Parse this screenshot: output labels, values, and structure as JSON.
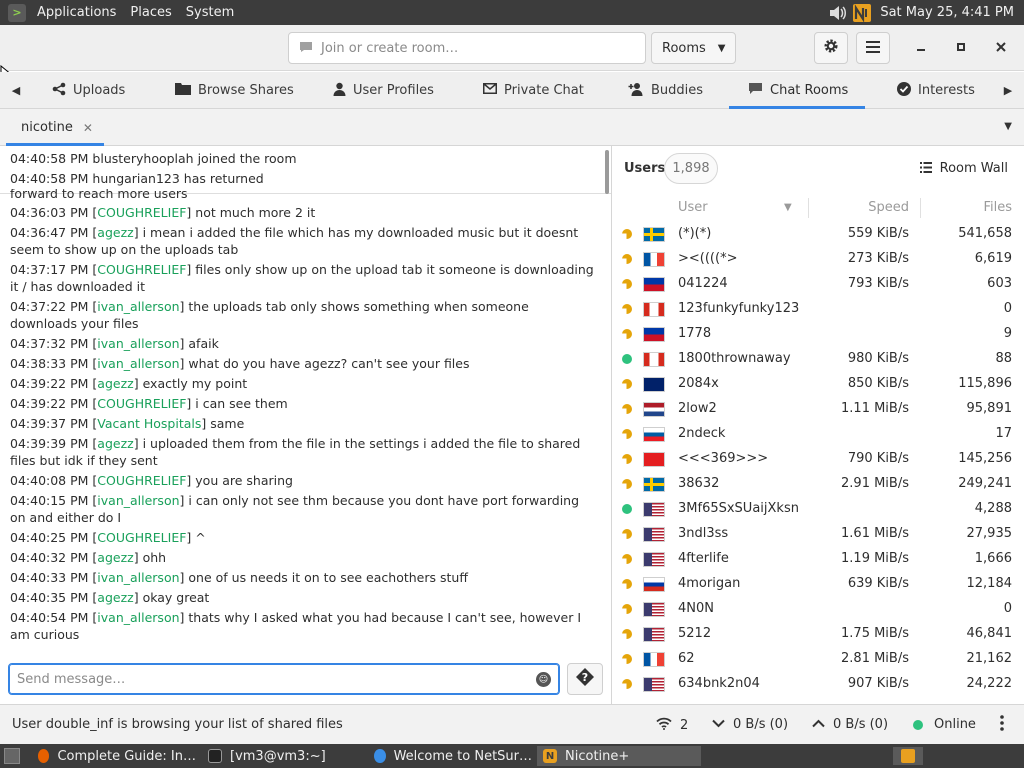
{
  "top_panel": {
    "menus": [
      "Applications",
      "Places",
      "System"
    ],
    "clock": "Sat May 25,  4:41 PM"
  },
  "header": {
    "search_placeholder": "Join or create room…",
    "rooms_label": "Rooms"
  },
  "tabs": [
    {
      "label": "Uploads",
      "icon": "share-icon"
    },
    {
      "label": "Browse Shares",
      "icon": "folder-icon"
    },
    {
      "label": "User Profiles",
      "icon": "person-icon"
    },
    {
      "label": "Private Chat",
      "icon": "envelope-icon"
    },
    {
      "label": "Buddies",
      "icon": "add-person-icon"
    },
    {
      "label": "Chat Rooms",
      "icon": "chat-icon",
      "active": true
    },
    {
      "label": "Interests",
      "icon": "check-circle-icon"
    }
  ],
  "room_tab": {
    "label": "nicotine"
  },
  "chat": {
    "pinned": [
      {
        "time": "04:40:58 PM",
        "text": "blusteryhooplah joined the room"
      },
      {
        "time": "04:40:58 PM",
        "text": "hungarian123 has returned"
      }
    ],
    "partial_line": "forward to reach more users",
    "messages": [
      {
        "time": "04:36:03 PM",
        "user": "COUGHRELIEF",
        "text": "not much more 2 it"
      },
      {
        "time": "04:36:47 PM",
        "user": "agezz",
        "text": "i mean i added the file which has my downloaded music but it doesnt seem to show up on the uploads tab"
      },
      {
        "time": "04:37:17 PM",
        "user": "COUGHRELIEF",
        "text": "files only show up on the upload tab it someone is downloading it / has downloaded it"
      },
      {
        "time": "04:37:22 PM",
        "user": "ivan_allerson",
        "text": "the uploads tab only shows something when someone downloads your files"
      },
      {
        "time": "04:37:32 PM",
        "user": "ivan_allerson",
        "text": "afaik"
      },
      {
        "time": "04:38:33 PM",
        "user": "ivan_allerson",
        "text": "what do you have agezz? can't see your files"
      },
      {
        "time": "04:39:22 PM",
        "user": "agezz",
        "text": "exactly my point"
      },
      {
        "time": "04:39:22 PM",
        "user": "COUGHRELIEF",
        "text": "i can see them"
      },
      {
        "time": "04:39:37 PM",
        "user": "Vacant Hospitals",
        "text": "same"
      },
      {
        "time": "04:39:39 PM",
        "user": "agezz",
        "text": "i uploaded them from the file in the settings i added the file to shared files but idk if they sent"
      },
      {
        "time": "04:40:08 PM",
        "user": "COUGHRELIEF",
        "text": "you are sharing"
      },
      {
        "time": "04:40:15 PM",
        "user": "ivan_allerson",
        "text": "i can only not see thm because you dont have port forwarding on and either do I"
      },
      {
        "time": "04:40:25 PM",
        "user": "COUGHRELIEF",
        "text": "^"
      },
      {
        "time": "04:40:32 PM",
        "user": "agezz",
        "text": "ohh"
      },
      {
        "time": "04:40:33 PM",
        "user": "ivan_allerson",
        "text": "one of us needs it on to see eachothers stuff"
      },
      {
        "time": "04:40:35 PM",
        "user": "agezz",
        "text": "okay great"
      },
      {
        "time": "04:40:54 PM",
        "user": "ivan_allerson",
        "text": "thats why I asked what you had because I can't see, however I am curious"
      }
    ],
    "input_placeholder": "Send message…"
  },
  "users_pane": {
    "label": "Users",
    "count": "1,898",
    "room_wall": "Room Wall",
    "columns": {
      "user": "User",
      "speed": "Speed",
      "files": "Files"
    },
    "users": [
      {
        "status": "away",
        "flag": "se",
        "name": "(*)(*)",
        "speed": "559 KiB/s",
        "files": "541,658"
      },
      {
        "status": "away",
        "flag": "fr",
        "name": "><((((*>",
        "speed": "273 KiB/s",
        "files": "6,619"
      },
      {
        "status": "away",
        "flag": "ph",
        "name": "041224",
        "speed": "793 KiB/s",
        "files": "603"
      },
      {
        "status": "away",
        "flag": "ca",
        "name": "123funkyfunky123",
        "speed": "",
        "files": "0"
      },
      {
        "status": "away",
        "flag": "ph",
        "name": "1778",
        "speed": "",
        "files": "9"
      },
      {
        "status": "online",
        "flag": "ca",
        "name": "1800thrownaway",
        "speed": "980 KiB/s",
        "files": "88"
      },
      {
        "status": "away",
        "flag": "au",
        "name": "2084x",
        "speed": "850 KiB/s",
        "files": "115,896"
      },
      {
        "status": "away",
        "flag": "nl",
        "name": "2low2",
        "speed": "1.11 MiB/s",
        "files": "95,891"
      },
      {
        "status": "away",
        "flag": "si",
        "name": "2ndeck",
        "speed": "",
        "files": "17"
      },
      {
        "status": "away",
        "flag": "al",
        "name": "<<<369>>>",
        "speed": "790 KiB/s",
        "files": "145,256"
      },
      {
        "status": "away",
        "flag": "se",
        "name": "38632",
        "speed": "2.91 MiB/s",
        "files": "249,241"
      },
      {
        "status": "online",
        "flag": "us",
        "name": "3Mf65SxSUaijXksn",
        "speed": "",
        "files": "4,288"
      },
      {
        "status": "away",
        "flag": "us",
        "name": "3ndl3ss",
        "speed": "1.61 MiB/s",
        "files": "27,935"
      },
      {
        "status": "away",
        "flag": "us",
        "name": "4fterlife",
        "speed": "1.19 MiB/s",
        "files": "1,666"
      },
      {
        "status": "away",
        "flag": "ru",
        "name": "4morigan",
        "speed": "639 KiB/s",
        "files": "12,184"
      },
      {
        "status": "away",
        "flag": "us",
        "name": "4N0N",
        "speed": "",
        "files": "0"
      },
      {
        "status": "away",
        "flag": "us",
        "name": "5212",
        "speed": "1.75 MiB/s",
        "files": "46,841"
      },
      {
        "status": "away",
        "flag": "fr",
        "name": "62",
        "speed": "2.81 MiB/s",
        "files": "21,162"
      },
      {
        "status": "away",
        "flag": "us",
        "name": "634bnk2n04",
        "speed": "907 KiB/s",
        "files": "24,222"
      }
    ]
  },
  "statusbar": {
    "text": "User double_inf is browsing your list of shared files",
    "connections": "2",
    "download": "0 B/s (0)",
    "upload": "0 B/s (0)",
    "online": "Online"
  },
  "taskbar": {
    "tasks": [
      {
        "label": "Complete Guide: In…",
        "icon": "firefox-icon"
      },
      {
        "label": "[vm3@vm3:~]",
        "icon": "terminal-icon"
      },
      {
        "label": "Welcome to NetSur…",
        "icon": "globe-icon"
      },
      {
        "label": "Nicotine+",
        "icon": "nicotine-icon",
        "active": true
      }
    ]
  },
  "colors": {
    "accent": "#3584e4",
    "username": "#19a05a",
    "away": "#e5a50a",
    "online": "#2ec27e"
  }
}
